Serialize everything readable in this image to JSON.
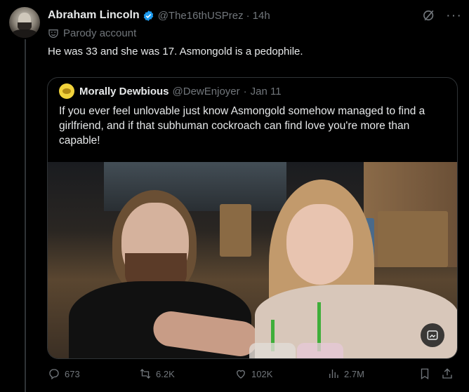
{
  "post": {
    "author_name": "Abraham Lincoln",
    "author_handle": "@The16thUSPrez",
    "separator": "·",
    "time": "14h",
    "parody_label": "Parody account",
    "text": "He was 33 and she was 17. Asmongold is a pedophile."
  },
  "quoted": {
    "author_name": "Morally Dewbious",
    "author_handle": "@DewEnjoyer",
    "separator": "·",
    "date": "Jan 11",
    "text": "If you ever feel unlovable just know Asmongold somehow managed to find a girlfriend, and if that subhuman cockroach can find love you're more than capable!"
  },
  "actions": {
    "replies": "673",
    "reposts": "6.2K",
    "likes": "102K",
    "views": "2.7M"
  },
  "colors": {
    "background": "#000000",
    "text_primary": "#e7e9ea",
    "text_secondary": "#71767b",
    "verified_blue": "#1d9bf0",
    "border": "#2f3336"
  },
  "icons": [
    "verified-icon",
    "grok-icon",
    "more-icon",
    "parody-icon",
    "reply-icon",
    "repost-icon",
    "like-icon",
    "views-icon",
    "bookmark-icon",
    "share-icon",
    "image-edit-icon"
  ]
}
